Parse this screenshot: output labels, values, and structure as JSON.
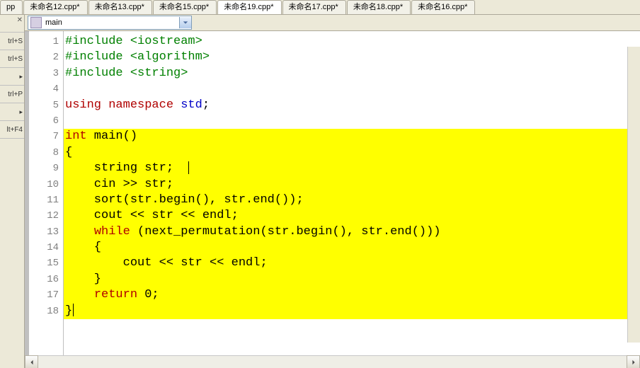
{
  "tabs": [
    {
      "label": "pp"
    },
    {
      "label": "未命名12.cpp*"
    },
    {
      "label": "未命名13.cpp*"
    },
    {
      "label": "未命名15.cpp*"
    },
    {
      "label": "未命名19.cpp*",
      "active": true
    },
    {
      "label": "未命名17.cpp*"
    },
    {
      "label": "未命名18.cpp*"
    },
    {
      "label": "未命名16.cpp*"
    }
  ],
  "shortcuts": [
    "trl+S",
    "trl+S",
    "",
    "trl+P",
    "",
    "lt+F4"
  ],
  "close_glyph": "✕",
  "arrow_glyph": "▸",
  "combo": {
    "text": "main"
  },
  "code": {
    "lines": [
      {
        "n": "1",
        "hl": false,
        "segs": [
          {
            "c": "kw-inc",
            "t": "#include <iostream>"
          }
        ]
      },
      {
        "n": "2",
        "hl": false,
        "segs": [
          {
            "c": "kw-inc",
            "t": "#include <algorithm>"
          }
        ]
      },
      {
        "n": "3",
        "hl": false,
        "segs": [
          {
            "c": "kw-inc",
            "t": "#include <string>"
          }
        ]
      },
      {
        "n": "4",
        "hl": false,
        "segs": []
      },
      {
        "n": "5",
        "hl": false,
        "segs": [
          {
            "c": "kw-red",
            "t": "using namespace "
          },
          {
            "c": "kw-blue",
            "t": "std"
          },
          {
            "t": ";"
          }
        ]
      },
      {
        "n": "6",
        "hl": false,
        "segs": []
      },
      {
        "n": "7",
        "hl": true,
        "segs": [
          {
            "c": "kw-red",
            "t": "int"
          },
          {
            "t": " main()"
          }
        ]
      },
      {
        "n": "8",
        "hl": true,
        "segs": [
          {
            "t": "{"
          }
        ]
      },
      {
        "n": "9",
        "hl": true,
        "segs": [
          {
            "t": "    string str;"
          }
        ],
        "caret": true
      },
      {
        "n": "10",
        "hl": true,
        "segs": [
          {
            "t": "    cin >> str;"
          }
        ]
      },
      {
        "n": "11",
        "hl": true,
        "segs": [
          {
            "t": "    sort(str.begin(), str.end());"
          }
        ]
      },
      {
        "n": "12",
        "hl": true,
        "segs": [
          {
            "t": "    cout << str << endl;"
          }
        ]
      },
      {
        "n": "13",
        "hl": true,
        "segs": [
          {
            "t": "    "
          },
          {
            "c": "kw-red",
            "t": "while"
          },
          {
            "t": " (next_permutation(str.begin(), str.end()))"
          }
        ]
      },
      {
        "n": "14",
        "hl": true,
        "segs": [
          {
            "t": "    {"
          }
        ]
      },
      {
        "n": "15",
        "hl": true,
        "segs": [
          {
            "t": "        cout << str << endl;"
          }
        ]
      },
      {
        "n": "16",
        "hl": true,
        "segs": [
          {
            "t": "    }"
          }
        ]
      },
      {
        "n": "17",
        "hl": true,
        "segs": [
          {
            "t": "    "
          },
          {
            "c": "kw-red",
            "t": "return"
          },
          {
            "t": " 0;"
          }
        ]
      },
      {
        "n": "18",
        "hl": true,
        "segs": [
          {
            "t": "}"
          }
        ],
        "endcaret": true
      }
    ]
  }
}
